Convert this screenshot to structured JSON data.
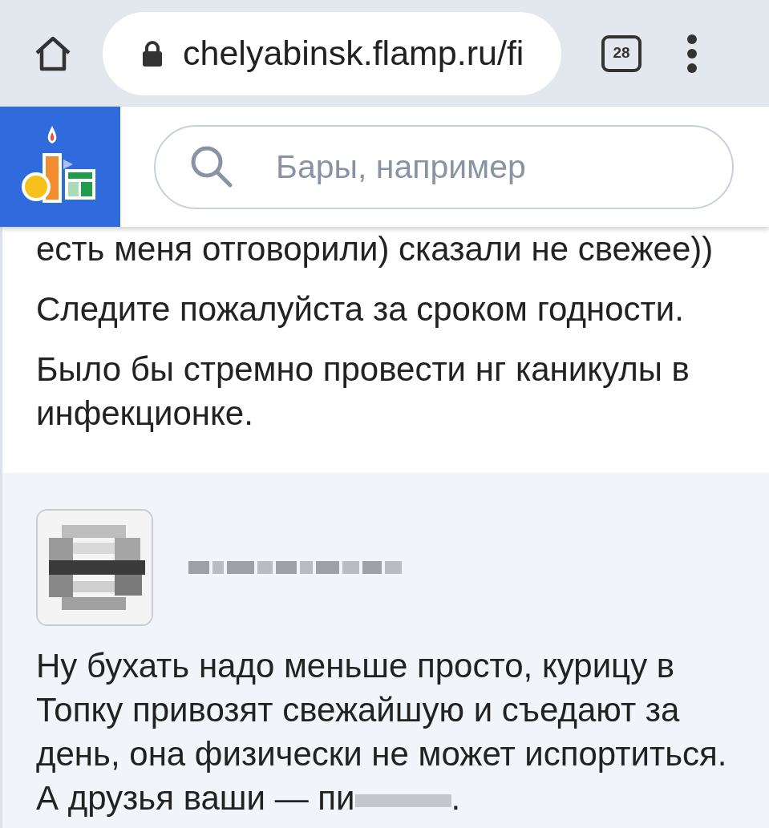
{
  "browser": {
    "url": "chelyabinsk.flamp.ru/fi",
    "tab_count": "28"
  },
  "site_header": {
    "search": {
      "placeholder": "Бары, например"
    }
  },
  "reviews": [
    {
      "kind": "text",
      "paragraphs": [
        {
          "parts": [
            "есть меня отговорили) сказали не свежее))"
          ]
        },
        {
          "parts": [
            "Следите пожалуйста за сроком годности."
          ]
        },
        {
          "parts": [
            "Было бы стремно провести нг каникулы в инфекционке."
          ]
        }
      ]
    },
    {
      "kind": "comment",
      "author_redacted": true,
      "paragraphs": [
        {
          "parts": [
            "Ну бухать надо меньше просто, курицу в Топку привозят свежайшую и съедают за день, она физически не может испортиться. А друзья ваши — пи",
            "."
          ]
        }
      ]
    }
  ]
}
